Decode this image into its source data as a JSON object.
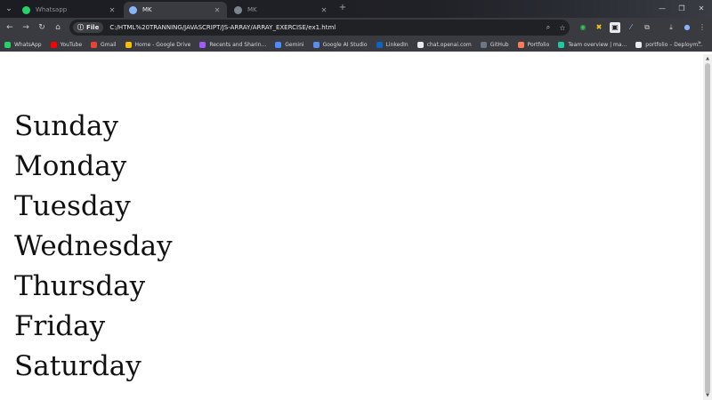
{
  "tabs": [
    {
      "title": "Whatsapp",
      "icon": "whatsapp-icon",
      "active": false
    },
    {
      "title": "MK",
      "icon": "globe-icon",
      "active": true
    },
    {
      "title": "MK",
      "icon": "globe-icon",
      "active": false
    }
  ],
  "toolbar": {
    "chip_label": "File",
    "url": "C:/HTML%20TRANNING/JAVASCRIPT/JS-ARRAY/ARRAY_EXERCISE/ex1.html"
  },
  "bookmarks": [
    {
      "label": "WhatsApp",
      "color": "#25d366"
    },
    {
      "label": "YouTube",
      "color": "#ff0000"
    },
    {
      "label": "Gmail",
      "color": "#ea4335"
    },
    {
      "label": "Home - Google Drive",
      "color": "#fbbc04"
    },
    {
      "label": "Recents and Sharin...",
      "color": "#a259ff"
    },
    {
      "label": "Gemini",
      "color": "#4a8cff"
    },
    {
      "label": "Google AI Studio",
      "color": "#5b8def"
    },
    {
      "label": "LinkedIn",
      "color": "#0a66c2"
    },
    {
      "label": "chat.openai.com",
      "color": "#e8eaed"
    },
    {
      "label": "GitHub",
      "color": "#6e7681"
    },
    {
      "label": "Portfolio",
      "color": "#ff7a59"
    },
    {
      "label": "Team overview | ma...",
      "color": "#1ec8a5"
    },
    {
      "label": "portfolio – Deploym...",
      "color": "#e8eaed"
    }
  ],
  "bookmarks_more": "»",
  "days": [
    "Sunday",
    "Monday",
    "Tuesday",
    "Wednesday",
    "Thursday",
    "Friday",
    "Saturday"
  ]
}
